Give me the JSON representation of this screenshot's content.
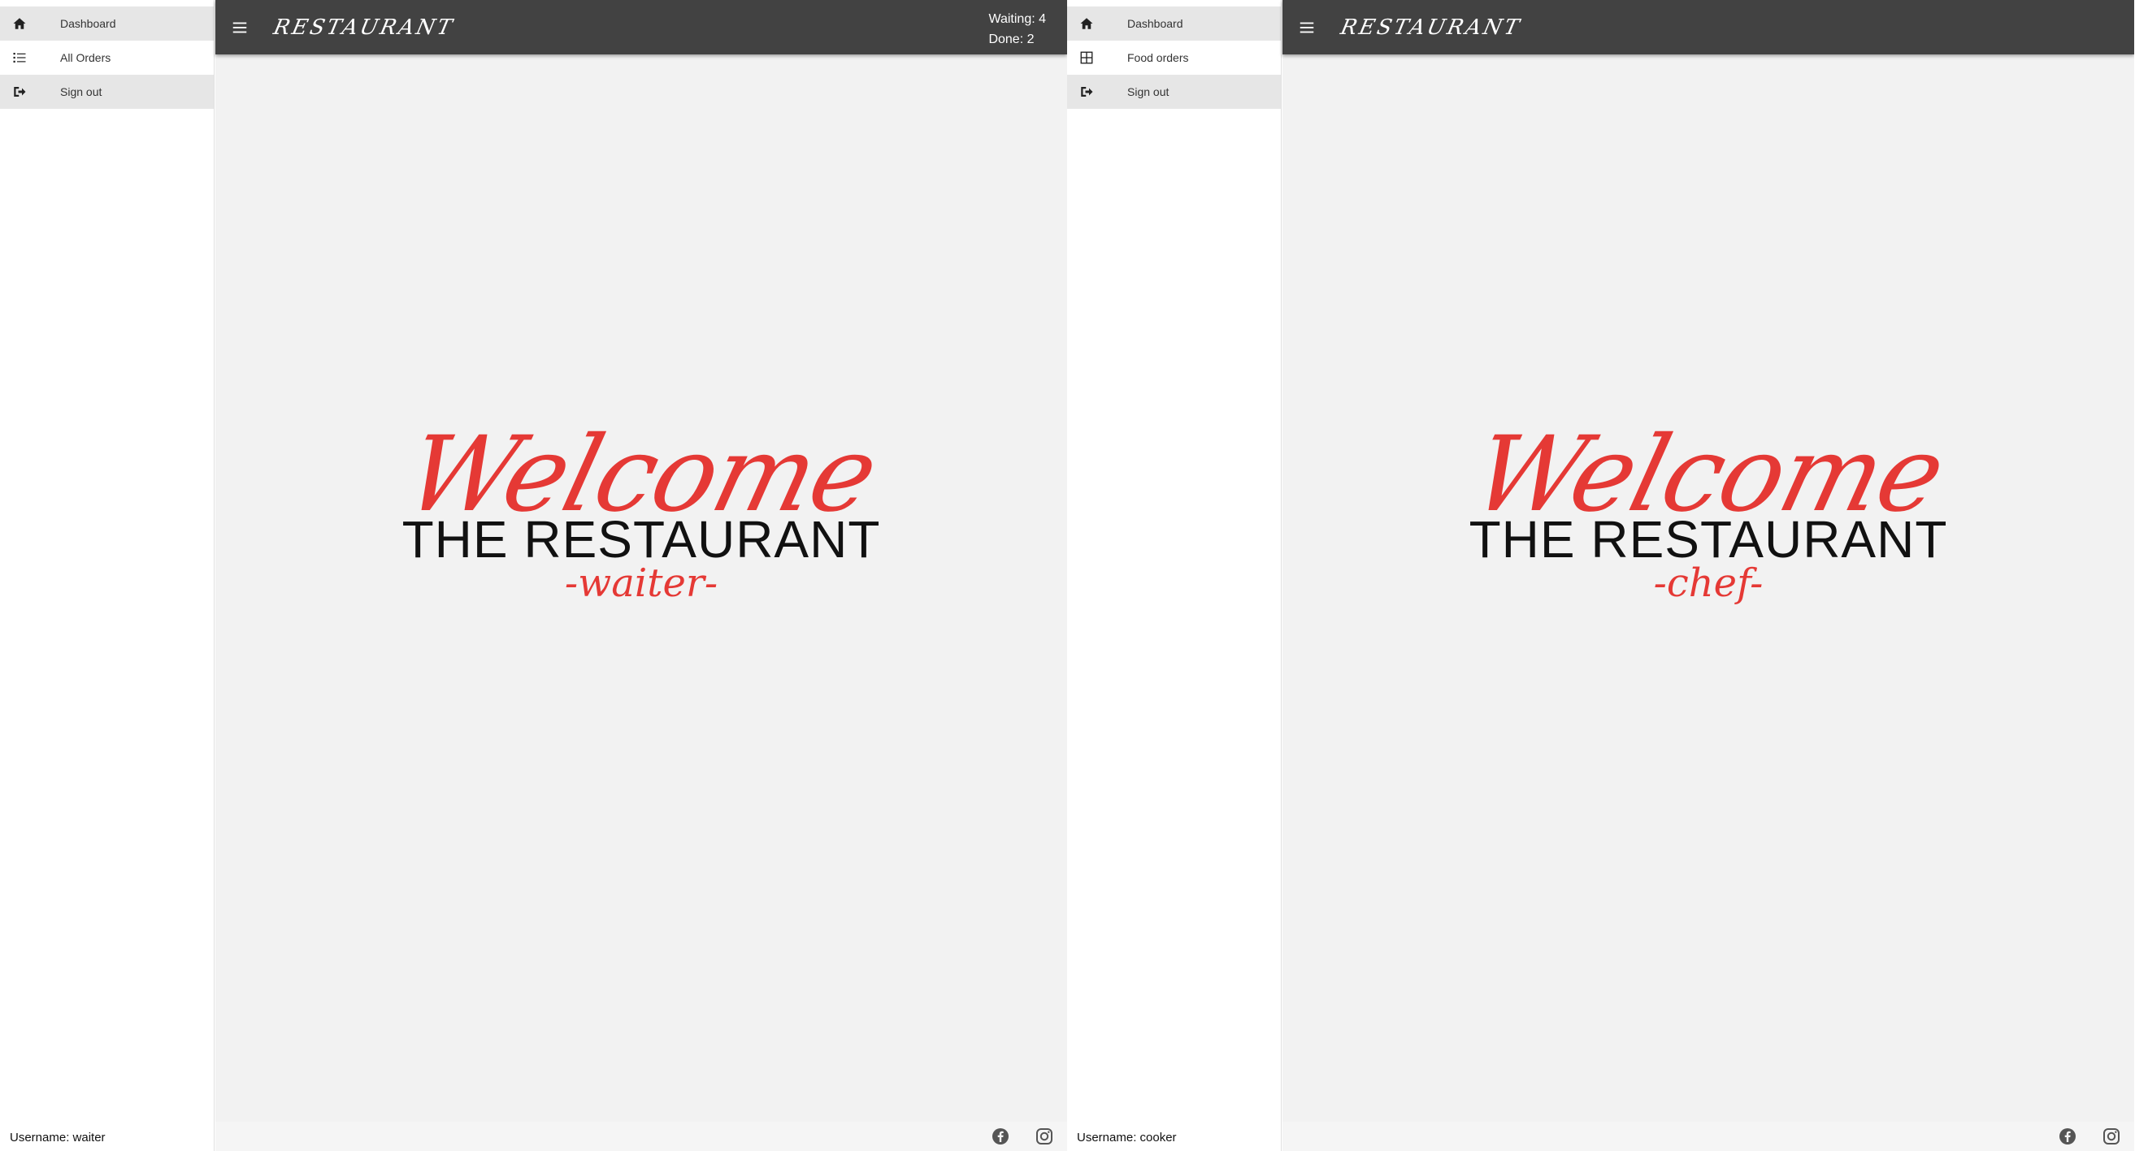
{
  "colors": {
    "appbar": "#424242",
    "main_background": "#f2f2f2",
    "accent_red": "#e53935",
    "menu_highlight": "#e6e6e6"
  },
  "waiter_screen": {
    "app_title": "RESTAURANT",
    "status": {
      "waiting": "Waiting: 4",
      "done": "Done: 2"
    },
    "sidebar": {
      "items": [
        {
          "label": "Dashboard",
          "icon": "home-icon"
        },
        {
          "label": "All Orders",
          "icon": "list-icon"
        },
        {
          "label": "Sign out",
          "icon": "sign-out-icon"
        }
      ],
      "username": "Username: waiter"
    },
    "hero": {
      "welcome": "Welcome",
      "brand": "THE RESTAURANT",
      "role": "-waiter-"
    },
    "footer_icons": [
      "facebook-icon",
      "instagram-icon"
    ]
  },
  "chef_screen": {
    "app_title": "RESTAURANT",
    "sidebar": {
      "items": [
        {
          "label": "Dashboard",
          "icon": "home-icon"
        },
        {
          "label": "Food orders",
          "icon": "grid-icon"
        },
        {
          "label": "Sign out",
          "icon": "sign-out-icon"
        }
      ],
      "username": "Username: cooker"
    },
    "hero": {
      "welcome": "Welcome",
      "brand": "THE RESTAURANT",
      "role": "-chef-"
    },
    "footer_icons": [
      "facebook-icon",
      "instagram-icon"
    ]
  }
}
